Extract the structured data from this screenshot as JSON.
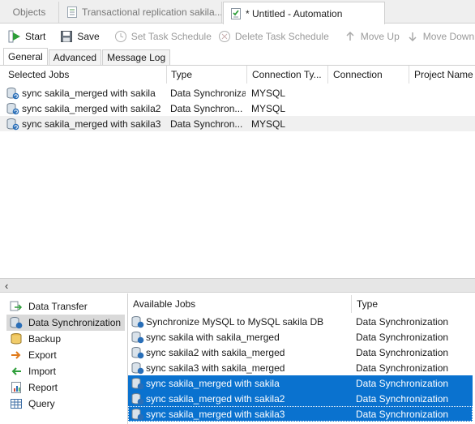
{
  "doc_tabs": [
    {
      "label": "Objects",
      "icon": "objects-tab",
      "active": false
    },
    {
      "label": "Transactional replication sakila...",
      "icon": "replication-doc-icon",
      "active": false
    },
    {
      "label": "* Untitled - Automation",
      "icon": "automation-icon",
      "active": true
    }
  ],
  "toolbar": {
    "start": "Start",
    "save": "Save",
    "set_schedule": "Set Task Schedule",
    "delete_schedule": "Delete Task Schedule",
    "move_up": "Move Up",
    "move_down": "Move Down"
  },
  "subtabs": [
    "General",
    "Advanced",
    "Message Log"
  ],
  "selected_jobs": {
    "columns": [
      "Selected Jobs",
      "Type",
      "Connection Ty...",
      "Connection",
      "Project Name"
    ],
    "rows": [
      {
        "name": "sync sakila_merged with sakila",
        "type": "Data Synchronization",
        "conn_type": "MYSQL"
      },
      {
        "name": "sync sakila_merged with sakila2",
        "type": "Data Synchron...",
        "conn_type": "MYSQL"
      },
      {
        "name": "sync sakila_merged with sakila3",
        "type": "Data Synchron...",
        "conn_type": "MYSQL"
      }
    ]
  },
  "splitter_icon": "chevron-left-icon",
  "categories": [
    {
      "label": "Data Transfer",
      "icon": "data-transfer-icon"
    },
    {
      "label": "Data Synchronization",
      "icon": "data-sync-icon",
      "selected": true
    },
    {
      "label": "Backup",
      "icon": "backup-icon"
    },
    {
      "label": "Export",
      "icon": "export-icon"
    },
    {
      "label": "Import",
      "icon": "import-icon"
    },
    {
      "label": "Report",
      "icon": "report-icon"
    },
    {
      "label": "Query",
      "icon": "query-icon"
    }
  ],
  "available_jobs": {
    "columns": [
      "Available Jobs",
      "Type"
    ],
    "rows": [
      {
        "name": "Synchronize MySQL to MySQL sakila DB",
        "type": "Data Synchronization",
        "selected": false
      },
      {
        "name": "sync sakila with sakila_merged",
        "type": "Data Synchronization",
        "selected": false
      },
      {
        "name": "sync sakila2 with sakila_merged",
        "type": "Data Synchronization",
        "selected": false
      },
      {
        "name": "sync sakila3 with sakila_merged",
        "type": "Data Synchronization",
        "selected": false
      },
      {
        "name": "sync sakila_merged with sakila",
        "type": "Data Synchronization",
        "selected": true
      },
      {
        "name": "sync sakila_merged with sakila2",
        "type": "Data Synchronization",
        "selected": true
      },
      {
        "name": "sync sakila_merged with sakila3",
        "type": "Data Synchronization",
        "selected": true
      }
    ]
  },
  "colors": {
    "selection": "#0a72cf",
    "start_green": "#2e9e3a",
    "sync_blue": "#2a6fb8"
  }
}
